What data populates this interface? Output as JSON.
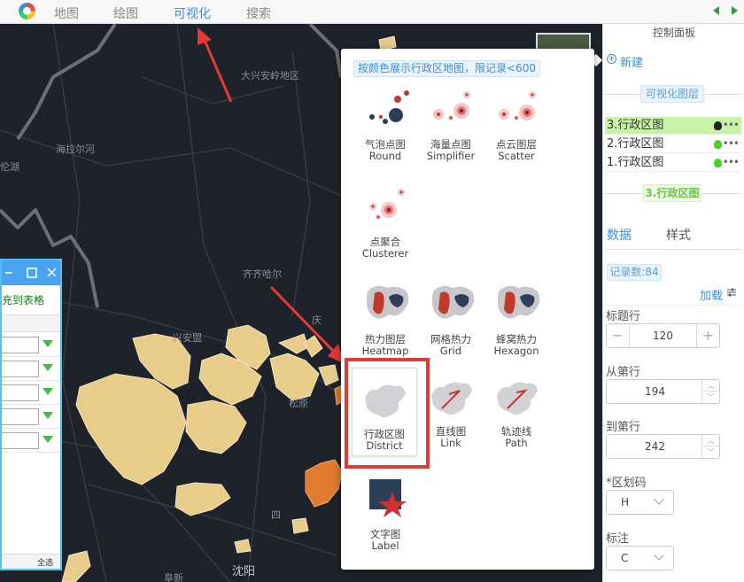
{
  "topbar": {
    "nav": [
      "地图",
      "绘图",
      "可视化",
      "搜索"
    ],
    "active": "可视化"
  },
  "map": {
    "labels": [
      "大兴安岭地区",
      "海拉尔河",
      "伦湖",
      "齐齐哈尔",
      "兴安盟",
      "松原",
      "庆",
      "沈阳",
      "阜新",
      "四"
    ]
  },
  "dialog": {
    "header_text": "充到表格",
    "footer_text": "全选"
  },
  "popup": {
    "hint": "按颜色展示行政区地图，限记录<600",
    "items": [
      {
        "zh": "气泡点图",
        "en": "Round"
      },
      {
        "zh": "海量点图",
        "en": "Simplifier"
      },
      {
        "zh": "点云图层",
        "en": "Scatter"
      },
      {
        "zh": "点聚合",
        "en": "Clusterer"
      },
      {
        "zh": "热力图层",
        "en": "Heatmap"
      },
      {
        "zh": "网格热力",
        "en": "Grid"
      },
      {
        "zh": "蜂窝热力",
        "en": "Hexagon"
      },
      {
        "zh": "行政区图",
        "en": "District"
      },
      {
        "zh": "直线图",
        "en": "Link"
      },
      {
        "zh": "轨迹线",
        "en": "Path"
      },
      {
        "zh": "文字图",
        "en": "Label"
      }
    ]
  },
  "panel": {
    "title": "控制面板",
    "new_label": "新建",
    "layers_header": "可视化图层",
    "layers": [
      "3.行政区图",
      "2.行政区图",
      "1.行政区图"
    ],
    "current_layer": "3.行政区图",
    "tabs": [
      "数据",
      "样式"
    ],
    "record_count": "记录数:84",
    "load_label": "加载",
    "fields": {
      "title_row": {
        "label": "标题行",
        "value": "120"
      },
      "from_row": {
        "label": "从第行",
        "value": "194"
      },
      "to_row": {
        "label": "到第行",
        "value": "242"
      },
      "region_code": {
        "label": "*区划码",
        "value": "H"
      },
      "annotation": {
        "label": "标注",
        "value": "C"
      }
    }
  },
  "colors": {
    "accent": "#3a8ee6",
    "highlight": "#e53935",
    "map_region_fill": "#e8cc8a",
    "map_region_dark": "#e07b30"
  }
}
